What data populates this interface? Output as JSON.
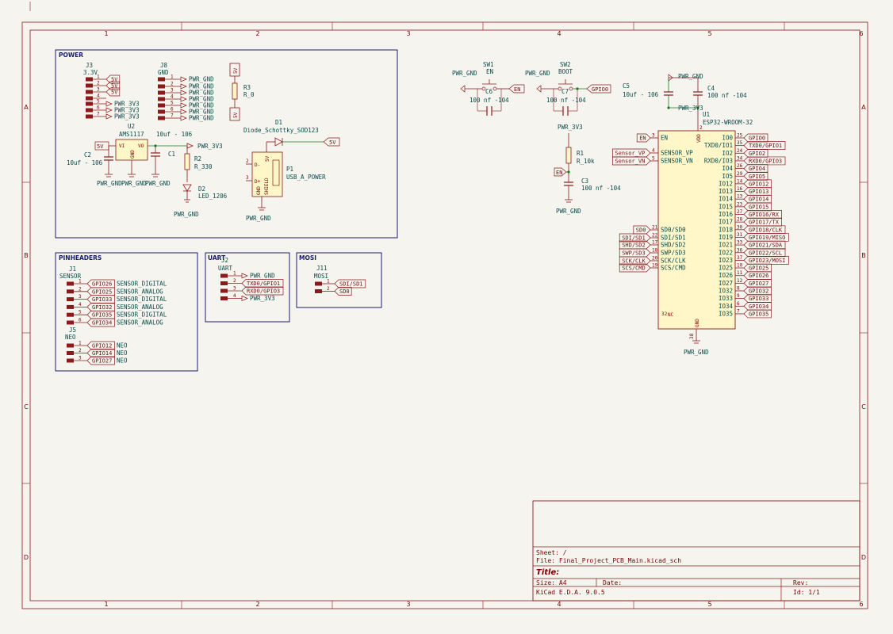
{
  "grid": {
    "cols": [
      "1",
      "2",
      "3",
      "4",
      "5",
      "6"
    ],
    "rows": [
      "A",
      "B",
      "C",
      "D"
    ]
  },
  "sheets": {
    "power": "POWER",
    "pinheaders": "PINHEADERS",
    "uart": "UART",
    "mosi": "MOSI"
  },
  "power": {
    "j3_ref": "J3",
    "j3_val": "3.3V",
    "j3_pins": [
      "5V",
      "5V",
      "5V",
      "PWR_3V3",
      "PWR_3V3",
      "PWR_3V3"
    ],
    "j3_nums": [
      "1",
      "2",
      "3",
      "4",
      "5",
      "6",
      "7"
    ],
    "j8_ref": "J8",
    "j8_val": "GND",
    "j8_pins": [
      "PWR_GND",
      "PWR_GND",
      "PWR_GND",
      "PWR_GND",
      "PWR_GND",
      "PWR_GND",
      "PWR_GND"
    ],
    "r3_ref": "R3",
    "r3_val": "R_0",
    "r3_net": "5V",
    "u2_ref": "U2",
    "u2_val": "AMS1117",
    "u2_vi": "VI",
    "u2_vo": "VO",
    "u2_gnd": "GND",
    "c2_ref": "C2",
    "c2_val": "10uf - 106",
    "c1_ref": "C1",
    "c1_val": "10uf - 106",
    "r2_ref": "R2",
    "r2_val": "R_330",
    "d2_ref": "D2",
    "d2_val": "LED_1206",
    "d1_ref": "D1",
    "d1_val": "Diode_Schottky_SOD123",
    "p1_ref": "P1",
    "p1_val": "USB_A_POWER",
    "p1_pins": [
      "5V",
      "D-",
      "D+",
      "GND",
      "SHIELD"
    ],
    "net_5v": "5V",
    "net_3v3": "PWR_3V3",
    "net_gnd": "PWR_GND"
  },
  "pinheaders": {
    "j1_ref": "J1",
    "j1_val": "SENSOR",
    "j1_rows": [
      {
        "n": "1",
        "g": "GPIO26",
        "s": "SENSOR_DIGITAL"
      },
      {
        "n": "2",
        "g": "GPIO25",
        "s": "SENSOR_ANALOG"
      },
      {
        "n": "3",
        "g": "GPIO33",
        "s": "SENSOR_DIGITAL"
      },
      {
        "n": "4",
        "g": "GPIO32",
        "s": "SENSOR_ANALOG"
      },
      {
        "n": "5",
        "g": "GPIO35",
        "s": "SENSOR_DIGITAL"
      },
      {
        "n": "6",
        "g": "GPIO34",
        "s": "SENSOR_ANALOG"
      }
    ],
    "j5_ref": "J5",
    "j5_val": "NEO",
    "j5_rows": [
      {
        "n": "1",
        "g": "GPIO12",
        "s": "NEO"
      },
      {
        "n": "2",
        "g": "GPIO14",
        "s": "NEO"
      },
      {
        "n": "3",
        "g": "GPIO27",
        "s": "NEO"
      }
    ]
  },
  "uart": {
    "j2_ref": "J2",
    "j2_val": "UART",
    "rows": [
      {
        "n": "1",
        "s": "PWR_GND"
      },
      {
        "n": "2",
        "s": "TXD0/GPIO1"
      },
      {
        "n": "3",
        "s": "RXD0/GPIO3"
      },
      {
        "n": "4",
        "s": "PWR_3V3"
      }
    ]
  },
  "mosi": {
    "j11_ref": "J11",
    "j11_val": "MOSI",
    "rows": [
      {
        "n": "1",
        "s": "SDI/SD1"
      },
      {
        "n": "2",
        "s": "SD0"
      }
    ]
  },
  "switches": {
    "sw1_ref": "SW1",
    "sw1_val": "EN",
    "c6_ref": "C6",
    "c6_val": "100 nf -104",
    "sw2_ref": "SW2",
    "sw2_val": "BOOT",
    "c7_ref": "C7",
    "c7_val": "100 nf -104",
    "net_en": "EN",
    "net_gpio0": "GPIO0",
    "net_gnd": "PWR_GND",
    "net_3v3": "PWR_3V3",
    "r1_ref": "R1",
    "r1_val": "R_10k",
    "c3_ref": "C3",
    "c3_val": "100 nf -104"
  },
  "esp32": {
    "u1_ref": "U1",
    "u1_val": "ESP32-WROOM-32",
    "c5_ref": "C5",
    "c5_val": "10uf - 106",
    "c4_ref": "C4",
    "c4_val": "100 nf -104",
    "vdd": "VDD",
    "gnd": "GND",
    "nc": "NC",
    "net_gnd": "PWR_GND",
    "net_3v3": "PWR_3V3",
    "left_pins": [
      {
        "num": "3",
        "name": "EN",
        "net": "EN"
      },
      {
        "num": "4",
        "name": "SENSOR_VP",
        "net": "Sensor_VP"
      },
      {
        "num": "5",
        "name": "SENSOR_VN",
        "net": "Sensor_VN"
      },
      {
        "num": "21",
        "name": "SD0/SD0",
        "net": "SD0"
      },
      {
        "num": "22",
        "name": "SDI/SD1",
        "net": "SDI/SD1"
      },
      {
        "num": "17",
        "name": "SHD/SD2",
        "net": "SHD/SD2"
      },
      {
        "num": "18",
        "name": "SWP/SD3",
        "net": "SWP/SD3"
      },
      {
        "num": "20",
        "name": "SCK/CLK",
        "net": "SCK/CLK"
      },
      {
        "num": "19",
        "name": "SCS/CMD",
        "net": "SCS/CMD"
      }
    ],
    "right_pins": [
      {
        "num": "25",
        "name": "IO0",
        "net": "GPIO0"
      },
      {
        "num": "35",
        "name": "TXD0/IO1",
        "net": "TXD0/GPIO1"
      },
      {
        "num": "24",
        "name": "IO2",
        "net": "GPIO2"
      },
      {
        "num": "34",
        "name": "RXD0/IO3",
        "net": "RXD0/GPIO3"
      },
      {
        "num": "26",
        "name": "IO4",
        "net": "GPIO4"
      },
      {
        "num": "29",
        "name": "IO5",
        "net": "GPIO5"
      },
      {
        "num": "14",
        "name": "IO12",
        "net": "GPIO12"
      },
      {
        "num": "16",
        "name": "IO13",
        "net": "GPIO13"
      },
      {
        "num": "13",
        "name": "IO14",
        "net": "GPIO14"
      },
      {
        "num": "23",
        "name": "IO15",
        "net": "GPIO15"
      },
      {
        "num": "27",
        "name": "IO16",
        "net": "GPIO16/RX"
      },
      {
        "num": "28",
        "name": "IO17",
        "net": "GPIO17/TX"
      },
      {
        "num": "30",
        "name": "IO18",
        "net": "GPIO18/CLK"
      },
      {
        "num": "31",
        "name": "IO19",
        "net": "GPIO19/MISO"
      },
      {
        "num": "33",
        "name": "IO21",
        "net": "GPIO21/SDA"
      },
      {
        "num": "36",
        "name": "IO22",
        "net": "GPIO22/SCL"
      },
      {
        "num": "37",
        "name": "IO23",
        "net": "GPIO23/MOSI"
      },
      {
        "num": "10",
        "name": "IO25",
        "net": "GPIO25"
      },
      {
        "num": "11",
        "name": "IO26",
        "net": "GPIO26"
      },
      {
        "num": "12",
        "name": "IO27",
        "net": "GPIO27"
      },
      {
        "num": "8",
        "name": "IO32",
        "net": "GPIO32"
      },
      {
        "num": "9",
        "name": "IO33",
        "net": "GPIO33"
      },
      {
        "num": "6",
        "name": "IO34",
        "net": "GPIO34"
      },
      {
        "num": "7",
        "name": "IO35",
        "net": "GPIO35"
      }
    ],
    "gnd_num": "38",
    "vdd_num": "2",
    "nc_num": "32"
  },
  "title_block": {
    "sheet": "Sheet: /",
    "file": "File: Final_Project_PCB_Main.kicad_sch",
    "title": "Title:",
    "size": "Size: A4",
    "date": "Date:",
    "rev": "Rev:",
    "kicad": "KiCad E.D.A. 9.0.5",
    "id": "Id: 1/1"
  }
}
